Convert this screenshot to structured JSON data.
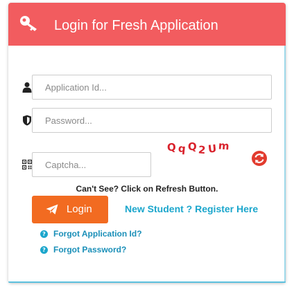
{
  "header": {
    "title": "Login for Fresh Application",
    "icon": "key-icon",
    "background": "#f25c5f"
  },
  "form": {
    "application_id": {
      "placeholder": "Application Id...",
      "value": "",
      "icon": "user-icon"
    },
    "password": {
      "placeholder": "Password...",
      "value": "",
      "icon": "shield-icon"
    },
    "captcha": {
      "placeholder": "Captcha...",
      "value": "",
      "icon": "qr-code-icon"
    },
    "captcha_image_text": "QqQ2Um",
    "refresh_icon": "refresh-icon",
    "refresh_hint": "Can't See? Click on Refresh Button."
  },
  "actions": {
    "login_label": "Login",
    "login_icon": "paper-plane-icon",
    "login_color": "#f26b21",
    "register_label": "New Student ? Register Here",
    "register_color": "#1ba6cc"
  },
  "help_links": [
    {
      "label": "Forgot Application Id?",
      "icon": "question-icon"
    },
    {
      "label": "Forgot Password?",
      "icon": "question-icon"
    }
  ]
}
